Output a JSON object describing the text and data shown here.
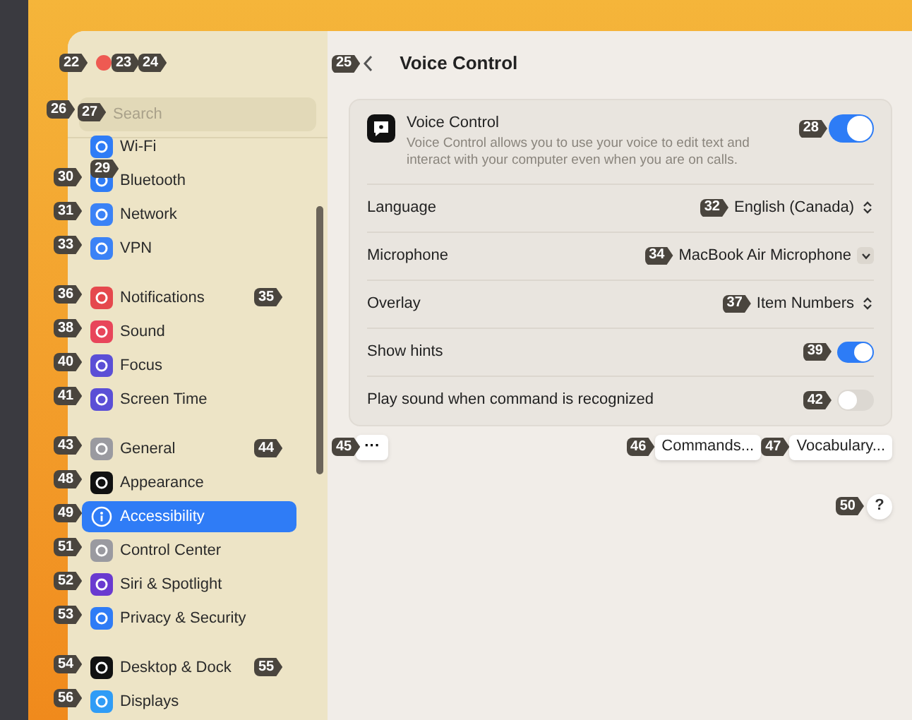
{
  "window": {
    "close_badge": "22",
    "control_badges": [
      "23",
      "24"
    ]
  },
  "sidebar": {
    "search": {
      "placeholder": "Search",
      "badges": [
        "26",
        "27"
      ]
    },
    "groups": [
      {
        "items": [
          {
            "label": "Wi-Fi",
            "badge": "29",
            "color": "#2f7cf6",
            "selected": false
          },
          {
            "label": "Bluetooth",
            "badge": "30",
            "color": "#2f7cf6",
            "selected": false
          },
          {
            "label": "Network",
            "badge": "31",
            "color": "#3b82f6",
            "selected": false
          },
          {
            "label": "VPN",
            "badge": "33",
            "color": "#3b82f6",
            "selected": false
          }
        ]
      },
      {
        "items": [
          {
            "label": "Notifications",
            "badge": "36",
            "extra_badge": "35",
            "color": "#e5484d",
            "selected": false
          },
          {
            "label": "Sound",
            "badge": "38",
            "color": "#e8455a",
            "selected": false
          },
          {
            "label": "Focus",
            "badge": "40",
            "color": "#5b4fd6",
            "selected": false
          },
          {
            "label": "Screen Time",
            "badge": "41",
            "color": "#5b4fd6",
            "selected": false
          }
        ]
      },
      {
        "items": [
          {
            "label": "General",
            "badge": "43",
            "extra_badge": "44",
            "color": "#9a9aa0",
            "selected": false
          },
          {
            "label": "Appearance",
            "badge": "48",
            "color": "#111111",
            "selected": false
          },
          {
            "label": "Accessibility",
            "badge": "49",
            "selected": true
          },
          {
            "label": "Control Center",
            "badge": "51",
            "color": "#9a9aa0",
            "selected": false
          },
          {
            "label": "Siri & Spotlight",
            "badge": "52",
            "color": "#6a3ad0",
            "selected": false
          },
          {
            "label": "Privacy & Security",
            "badge": "53",
            "color": "#2f7cf6",
            "selected": false
          }
        ]
      },
      {
        "items": [
          {
            "label": "Desktop & Dock",
            "badge": "54",
            "extra_badge": "55",
            "color": "#111111",
            "selected": false
          },
          {
            "label": "Displays",
            "badge": "56",
            "color": "#2f9cf6",
            "selected": false
          }
        ]
      }
    ]
  },
  "header": {
    "back_badge": "25",
    "title": "Voice Control"
  },
  "card": {
    "title": "Voice Control",
    "description": "Voice Control allows you to use your voice to edit text and interact with your computer even when you are on calls.",
    "badge": "28",
    "on": true,
    "rows": [
      {
        "kind": "popup",
        "label": "Language",
        "value": "English (Canada)",
        "badge": "32"
      },
      {
        "kind": "dropdown",
        "label": "Microphone",
        "value": "MacBook Air Microphone",
        "badge": "34"
      },
      {
        "kind": "popup",
        "label": "Overlay",
        "value": "Item Numbers",
        "badge": "37"
      },
      {
        "kind": "switch",
        "label": "Show hints",
        "on": true,
        "badge": "39"
      },
      {
        "kind": "switch",
        "label": "Play sound when command is recognized",
        "on": false,
        "badge": "42"
      }
    ]
  },
  "buttons": {
    "more": {
      "label": "···",
      "badge": "45"
    },
    "actions": [
      {
        "label": "Commands...",
        "badge": "46"
      },
      {
        "label": "Vocabulary...",
        "badge": "47"
      }
    ]
  },
  "help": {
    "label": "?",
    "badge": "50"
  }
}
